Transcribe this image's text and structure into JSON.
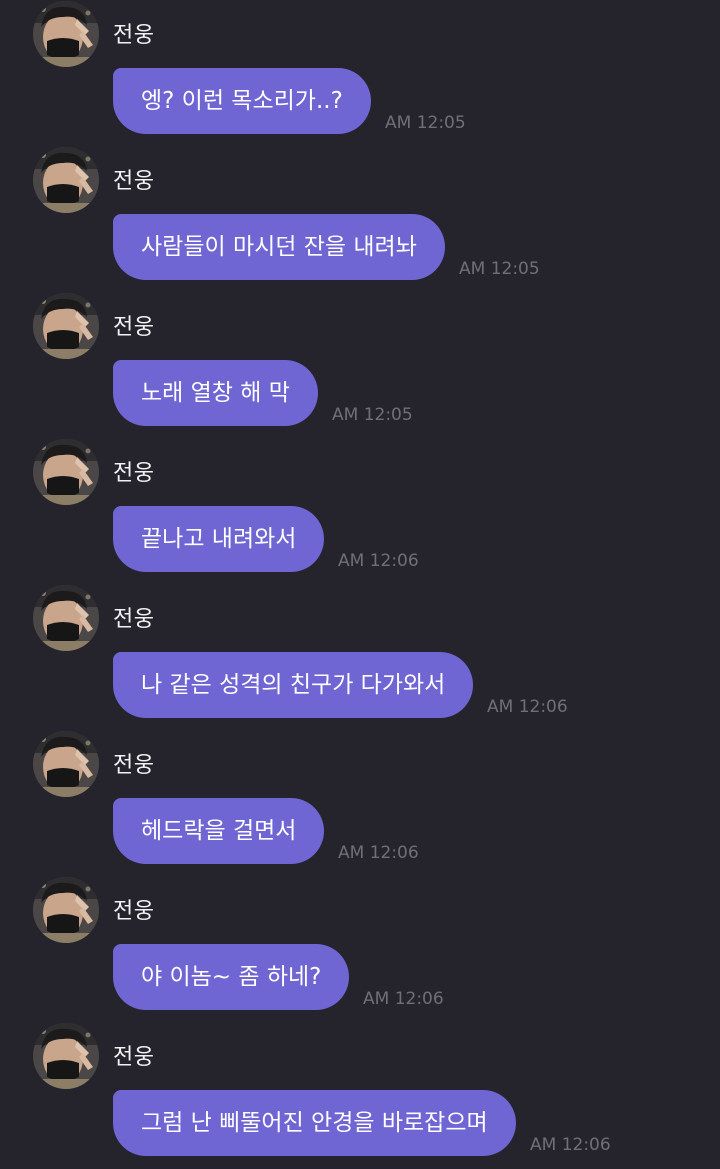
{
  "theme": {
    "background": "#25242c",
    "bubble_color": "#6f66d4",
    "bubble_text_color": "#ffffff",
    "name_color": "#f2f2f4",
    "time_color": "#6f6f78"
  },
  "messages": [
    {
      "sender": "전웅",
      "text": "엥? 이런 목소리가..?",
      "time": "AM 12:05",
      "avatar": "profile-photo"
    },
    {
      "sender": "전웅",
      "text": "사람들이 마시던 잔을 내려놔",
      "time": "AM 12:05",
      "avatar": "profile-photo"
    },
    {
      "sender": "전웅",
      "text": "노래 열창 해 막",
      "time": "AM 12:05",
      "avatar": "profile-photo"
    },
    {
      "sender": "전웅",
      "text": "끝나고 내려와서",
      "time": "AM 12:06",
      "avatar": "profile-photo"
    },
    {
      "sender": "전웅",
      "text": "나 같은 성격의 친구가 다가와서",
      "time": "AM 12:06",
      "avatar": "profile-photo"
    },
    {
      "sender": "전웅",
      "text": "헤드락을 걸면서",
      "time": "AM 12:06",
      "avatar": "profile-photo"
    },
    {
      "sender": "전웅",
      "text": "야 이놈~ 좀 하네?",
      "time": "AM 12:06",
      "avatar": "profile-photo"
    },
    {
      "sender": "전웅",
      "text": "그럼 난 삐뚤어진 안경을 바로잡으며",
      "time": "AM 12:06",
      "avatar": "profile-photo"
    }
  ]
}
